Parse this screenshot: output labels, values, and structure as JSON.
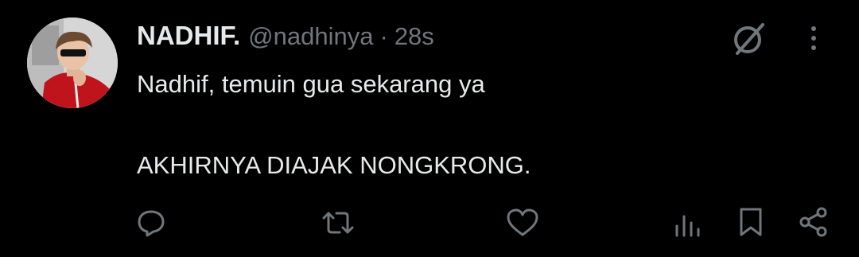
{
  "tweet": {
    "author_name": "NADHIF.",
    "handle": "@nadhinya",
    "separator": "·",
    "time": "28s",
    "line1": "Nadhif, temuin gua sekarang ya",
    "line2": "AKHIRNYA DIAJAK NONGKRONG."
  },
  "icons": {
    "grok": "grok-icon",
    "more": "more-icon",
    "reply": "reply-icon",
    "retweet": "retweet-icon",
    "like": "heart-icon",
    "views": "views-icon",
    "bookmark": "bookmark-icon",
    "share": "share-icon"
  },
  "colors": {
    "background": "#000000",
    "text": "#e7e9ea",
    "muted": "#71767b"
  }
}
